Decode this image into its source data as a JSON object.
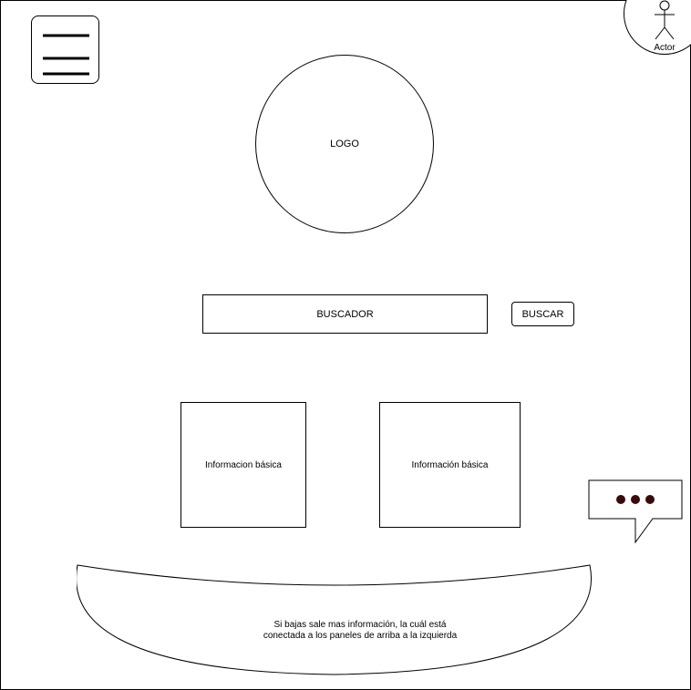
{
  "actor": {
    "label": "Actor",
    "icon": "person-icon"
  },
  "menu": {
    "icon": "hamburger-menu-icon"
  },
  "logo": {
    "label": "LOGO"
  },
  "search": {
    "field_label": "BUSCADOR",
    "button_label": "BUSCAR"
  },
  "panels": [
    {
      "label": "Informacion básica"
    },
    {
      "label": "Información básica"
    }
  ],
  "chat": {
    "icon": "chat-bubble-icon",
    "dot_color": "#3a0a0a"
  },
  "more_info": {
    "text": "Si bajas sale mas información, la cuál está conectada a los paneles de arriba a la izquierda"
  }
}
